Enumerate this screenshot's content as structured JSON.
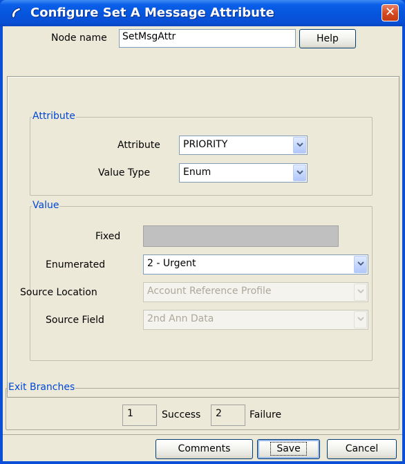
{
  "window": {
    "title": "Configure Set A Message Attribute",
    "title_icon": "phone-handset-icon",
    "close_icon": "close-icon"
  },
  "header": {
    "node_name_label": "Node name",
    "node_name_value": "SetMsgAttr",
    "help_label": "Help"
  },
  "attribute_group": {
    "title": "Attribute",
    "attribute_label": "Attribute",
    "attribute_value": "PRIORITY",
    "value_type_label": "Value Type",
    "value_type_value": "Enum"
  },
  "value_group": {
    "title": "Value",
    "fixed_label": "Fixed",
    "fixed_value": "",
    "enumerated_label": "Enumerated",
    "enumerated_value": "2 - Urgent",
    "source_location_label": "Source Location",
    "source_location_value": "Account Reference Profile",
    "source_field_label": "Source Field",
    "source_field_value": "2nd Ann Data"
  },
  "exit_branches": {
    "title": "Exit Branches",
    "branches": [
      {
        "number": "1",
        "label": "Success"
      },
      {
        "number": "2",
        "label": "Failure"
      }
    ]
  },
  "footer": {
    "comments_label": "Comments",
    "save_label": "Save",
    "cancel_label": "Cancel"
  },
  "colors": {
    "title_bar": "#0a4fd6",
    "group_title": "#0046d5",
    "dialog_bg": "#ece9d8"
  }
}
